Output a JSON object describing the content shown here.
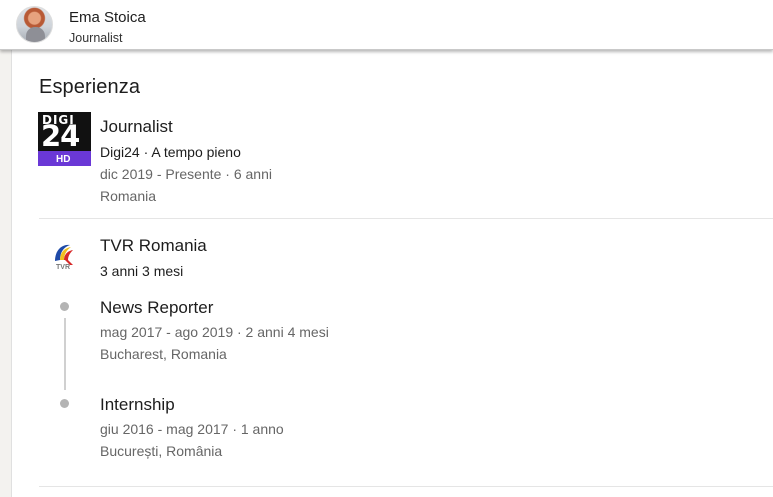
{
  "header": {
    "name": "Ema Stoica",
    "title": "Journalist"
  },
  "section": {
    "title": "Esperienza"
  },
  "experience": [
    {
      "logo": "digi24-hd-logo",
      "title": "Journalist",
      "company_line": "Digi24 · A tempo pieno",
      "dates": "dic 2019 - Presente · 6 anni",
      "location": "Romania"
    },
    {
      "logo": "tvr-logo",
      "company": "TVR Romania",
      "duration": "3 anni 3 mesi",
      "roles": [
        {
          "title": "News Reporter",
          "dates": "mag 2017 - ago 2019 · 2 anni 4 mesi",
          "location": "Bucharest, Romania"
        },
        {
          "title": "Internship",
          "dates": "giu 2016 - mag 2017 · 1 anno",
          "location": "București, România"
        }
      ]
    }
  ],
  "logos": {
    "digi": {
      "top_text": "DIGI",
      "number": "24",
      "badge": "HD"
    },
    "tvr": {
      "label": "TVR"
    }
  },
  "colors": {
    "hd_bar": "#6a38d6",
    "muted_text": "#666666",
    "timeline": "#b4b4b4"
  }
}
